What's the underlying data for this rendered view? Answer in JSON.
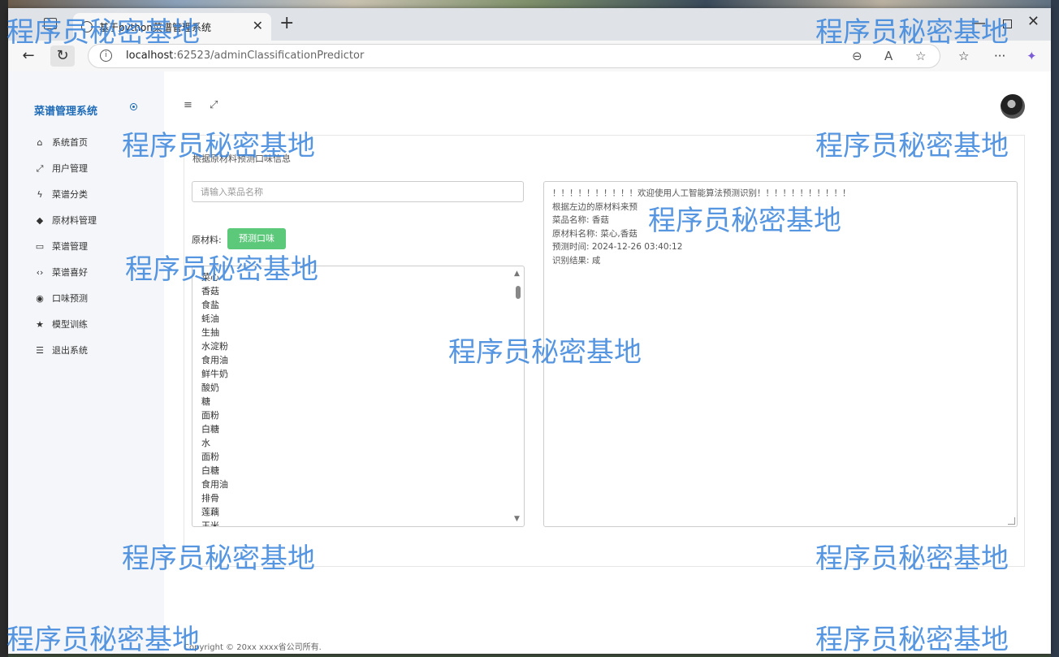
{
  "browser": {
    "tab_title": "基于python菜谱管理系统",
    "tab_close": "✕",
    "new_tab": "+",
    "url_host": "localhost",
    "url_rest": ":62523/adminClassificationPredictor"
  },
  "sidebar": {
    "brand": "菜谱管理系统",
    "items": [
      {
        "icon": "⌂",
        "label": "系统首页"
      },
      {
        "icon": "⤢",
        "label": "用户管理"
      },
      {
        "icon": "ϟ",
        "label": "菜谱分类"
      },
      {
        "icon": "◆",
        "label": "原材料管理"
      },
      {
        "icon": "▭",
        "label": "菜谱管理"
      },
      {
        "icon": "‹›",
        "label": "菜谱喜好"
      },
      {
        "icon": "◉",
        "label": "口味预测"
      },
      {
        "icon": "★",
        "label": "模型训练"
      },
      {
        "icon": "☰",
        "label": "退出系统"
      }
    ]
  },
  "topbar": {
    "menu_icon": "≡",
    "fullscreen_icon": "⤢"
  },
  "main": {
    "section_title": "根据原材料预测口味信息",
    "dish_input_placeholder": "请输入菜品名称",
    "ingredients_label": "原材料:",
    "predict_button": "预测口味",
    "ingredients": [
      "菜心",
      "香菇",
      "食盐",
      "蚝油",
      "生抽",
      "水淀粉",
      "食用油",
      "鲜牛奶",
      "酸奶",
      "糖",
      "面粉",
      "白糖",
      "水",
      "面粉",
      "白糖",
      "食用油",
      "排骨",
      "莲藕",
      "玉米"
    ],
    "result_lines": [
      "！！！！！！！！！！欢迎使用人工智能算法预测识别！！！！！！！！！！！",
      "根据左边的原材料来预",
      "菜品名称:  香菇",
      "原材料名称:  菜心,香菇",
      "预测时间:  2024-12-26 03:40:12",
      "识别结果:  咸"
    ]
  },
  "footer": "Copyright © 20xx xxxx省公司所有.",
  "watermark": "程序员秘密基地",
  "colors": {
    "brand": "#1e6bb8",
    "button": "#5cc87a",
    "watermark": "#3884dc"
  }
}
